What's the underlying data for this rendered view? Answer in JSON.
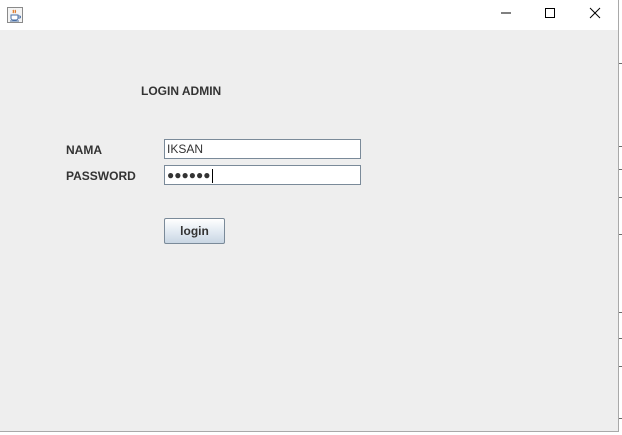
{
  "window": {
    "controls": {
      "minimize_icon": "minimize-icon",
      "maximize_icon": "maximize-icon",
      "close_icon": "close-icon"
    },
    "app_icon": "java-cup-icon"
  },
  "form": {
    "heading": "LOGIN ADMIN",
    "nama_label": "NAMA",
    "nama_value": "IKSAN",
    "password_label": "PASSWORD",
    "password_mask": "●●●●●●",
    "login_label": "login"
  },
  "colors": {
    "background": "#eeeeee",
    "field_border": "#7a8a99",
    "text": "#333333"
  }
}
